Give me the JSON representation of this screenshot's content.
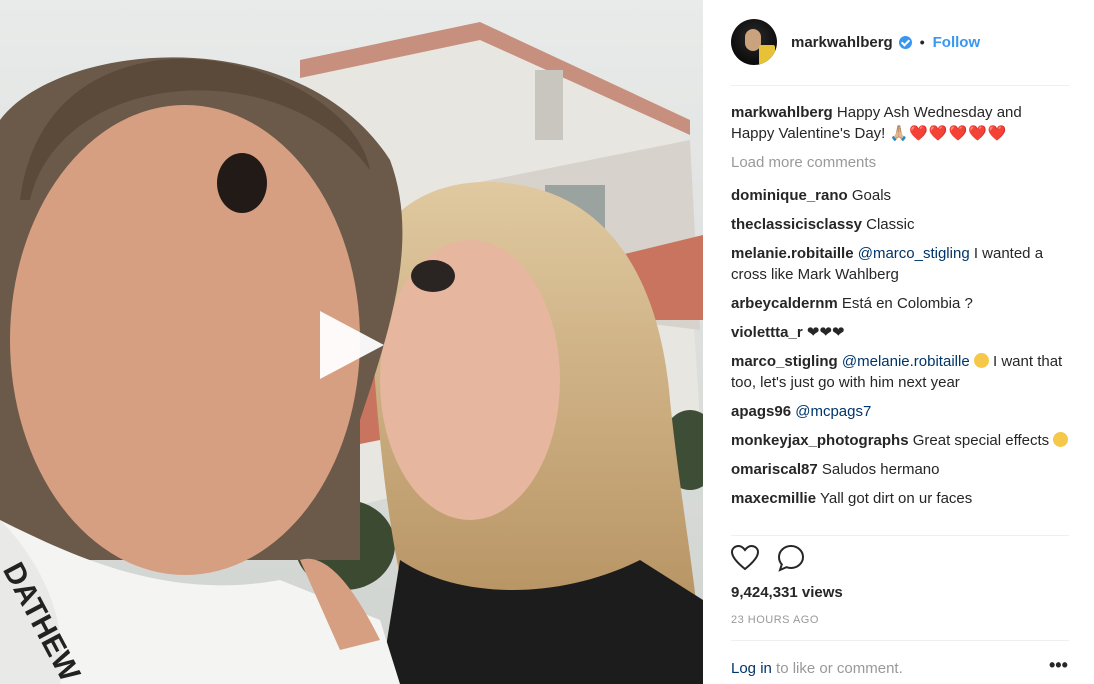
{
  "post": {
    "username": "markwahlberg",
    "separator": "•",
    "follow_label": "Follow",
    "caption": "Happy Ash Wednesday and Happy Valentine's Day!",
    "caption_emojis": "🙏🏼❤️❤️❤️❤️❤️",
    "load_more": "Load more comments",
    "views": "9,424,331 views",
    "time": "23 HOURS AGO",
    "login_link": "Log in",
    "login_rest": " to like or comment.",
    "more_options": "•••"
  },
  "comments": [
    {
      "user": "dominique_rano",
      "text": "Goals"
    },
    {
      "user": "theclassicisclassy",
      "text": "Classic"
    },
    {
      "user": "melanie.robitaille",
      "mention": "@marco_stigling",
      "text": " I wanted a cross like Mark Wahlberg"
    },
    {
      "user": "arbeycaldernm",
      "text": "Está en Colombia ?"
    },
    {
      "user": "violettta_r",
      "text": "❤❤❤"
    },
    {
      "user": "marco_stigling",
      "mention": "@melanie.robitaille",
      "text": " I want that too, let's just go with him next year"
    },
    {
      "user": "apags96",
      "mention": "@mcpags7",
      "text": ""
    },
    {
      "user": "monkeyjax_photographs",
      "text": "Great special effects"
    },
    {
      "user": "omariscal87",
      "text": "Saludos hermano"
    },
    {
      "user": "maxecmillie",
      "text": "Yall got dirt on ur faces"
    }
  ],
  "colors": {
    "link": "#3897f0",
    "mention": "#003569",
    "heart": "#ed1c24"
  },
  "icons": [
    "play-icon",
    "heart-icon",
    "comment-icon",
    "verified-badge-icon"
  ]
}
